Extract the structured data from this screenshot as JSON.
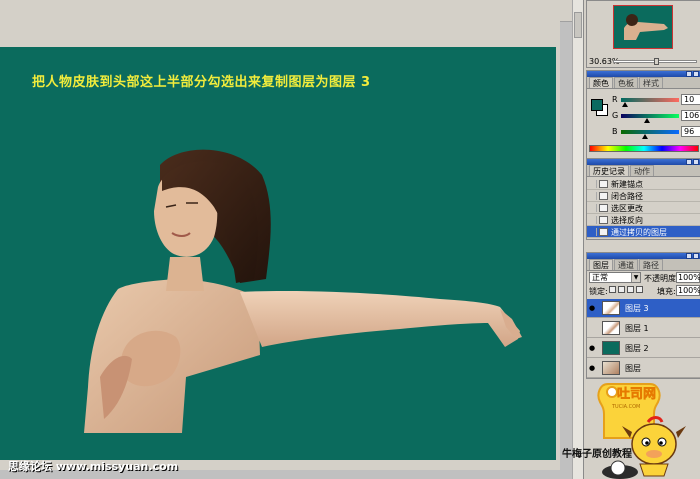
{
  "canvas": {
    "caption": "把人物皮肤到头部这上半部分勾选出来复制图层为图层 3",
    "background": "#0b6b5d",
    "caption_color": "#f2ec3c"
  },
  "navigator": {
    "zoom": "30.63%"
  },
  "color_panel": {
    "tabs": [
      "颜色",
      "色板",
      "样式"
    ],
    "active_tab": 0,
    "channels": [
      {
        "label": "R",
        "value": "10"
      },
      {
        "label": "G",
        "value": "106"
      },
      {
        "label": "B",
        "value": "96"
      }
    ],
    "fg_color": "#0b6a60"
  },
  "history_panel": {
    "tabs": [
      "历史记录",
      "动作"
    ],
    "items": [
      {
        "label": "新建锚点"
      },
      {
        "label": "闭合路径"
      },
      {
        "label": "选区更改"
      },
      {
        "label": "选择反向"
      },
      {
        "label": "通过拷贝的图层"
      }
    ],
    "active_index": 4
  },
  "layers_panel": {
    "tabs": [
      "图层",
      "通道",
      "路径"
    ],
    "blend_mode": "正常",
    "opacity_label": "不透明度:",
    "opacity": "100%",
    "lock_label": "锁定:",
    "fill_label": "填充:",
    "fill": "100%",
    "layers": [
      {
        "name": "图层 3",
        "visible": true,
        "selected": true
      },
      {
        "name": "图层 1",
        "visible": false,
        "selected": false
      },
      {
        "name": "图层 2",
        "visible": true,
        "selected": false
      },
      {
        "name": "图层",
        "visible": true,
        "selected": false
      }
    ]
  },
  "watermark": "思缘论坛  www.missyuan.com",
  "credit": "牛梅子原创教程",
  "logo": {
    "text": "吐司网",
    "subtext": "TUCIA.COM"
  }
}
